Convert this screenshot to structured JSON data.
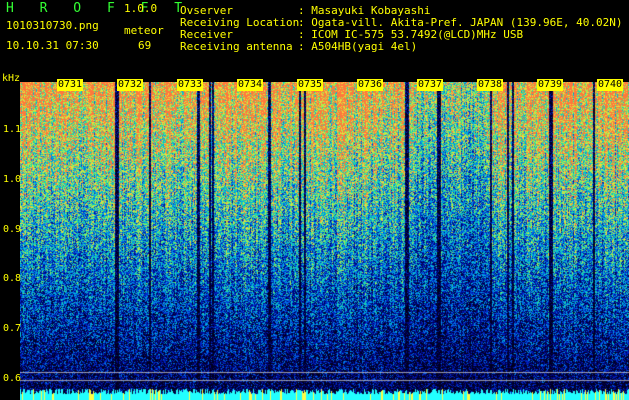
{
  "app": {
    "title": "H R O F F T",
    "version": "1.0.0"
  },
  "file": {
    "name": "1010310730.png",
    "datetime": "10.10.31 07:30"
  },
  "meteor": {
    "label": "meteor",
    "count": "69"
  },
  "info": [
    {
      "label": "Ovserver",
      "value": ": Masayuki Kobayashi"
    },
    {
      "label": "Receiving Location",
      "value": ": Ogata-vill. Akita-Pref. JAPAN (139.96E, 40.02N)"
    },
    {
      "label": "Receiver",
      "value": ": ICOM IC-575 53.7492(@LCD)MHz USB"
    },
    {
      "label": "Receiving antenna",
      "value": ": A504HB(yagi 4el)"
    }
  ],
  "axis": {
    "unit": "kHz",
    "yticks": [
      "1.1",
      "1.0",
      "0.9",
      "0.8",
      "0.7",
      "0.6"
    ],
    "time_labels": [
      "0731",
      "0732",
      "0733",
      "0734",
      "0735",
      "0736",
      "0737",
      "0738",
      "0739",
      "0740"
    ]
  },
  "colors": {
    "header_green": "#33ff33",
    "header_yellow": "#ffff00",
    "background": "#000000"
  }
}
